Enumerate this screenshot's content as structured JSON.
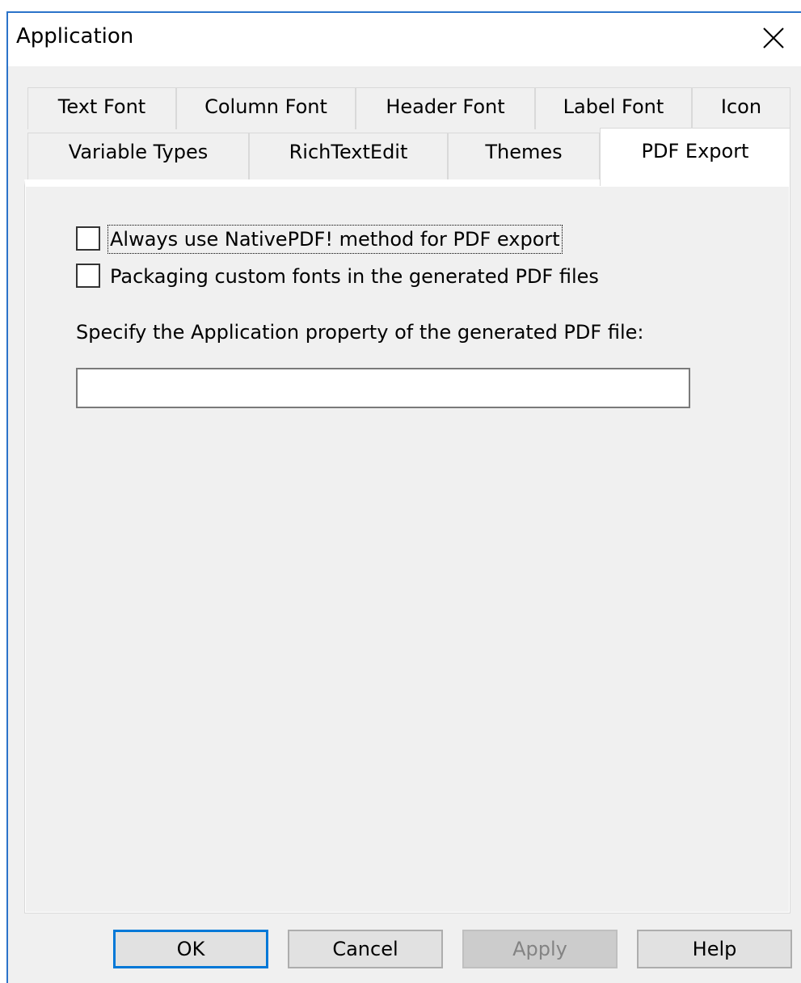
{
  "window": {
    "title": "Application"
  },
  "tabs": {
    "row1": [
      "Text Font",
      "Column Font",
      "Header Font",
      "Label Font",
      "Icon"
    ],
    "row2": [
      "Variable Types",
      "RichTextEdit",
      "Themes",
      "PDF Export"
    ],
    "active": "PDF Export"
  },
  "options": {
    "native_pdf": {
      "label": "Always use NativePDF! method for PDF export",
      "checked": false
    },
    "package_fonts": {
      "label": "Packaging custom fonts in the generated PDF files",
      "checked": false
    }
  },
  "app_property": {
    "label": "Specify the Application property of the generated PDF file:",
    "value": ""
  },
  "buttons": {
    "ok": "OK",
    "cancel": "Cancel",
    "apply": "Apply",
    "help": "Help"
  },
  "colors": {
    "accent": "#0078d7",
    "window_border": "#2b73c9",
    "dialog_bg": "#f0f0f0"
  },
  "icons": {
    "close": "close-icon"
  }
}
